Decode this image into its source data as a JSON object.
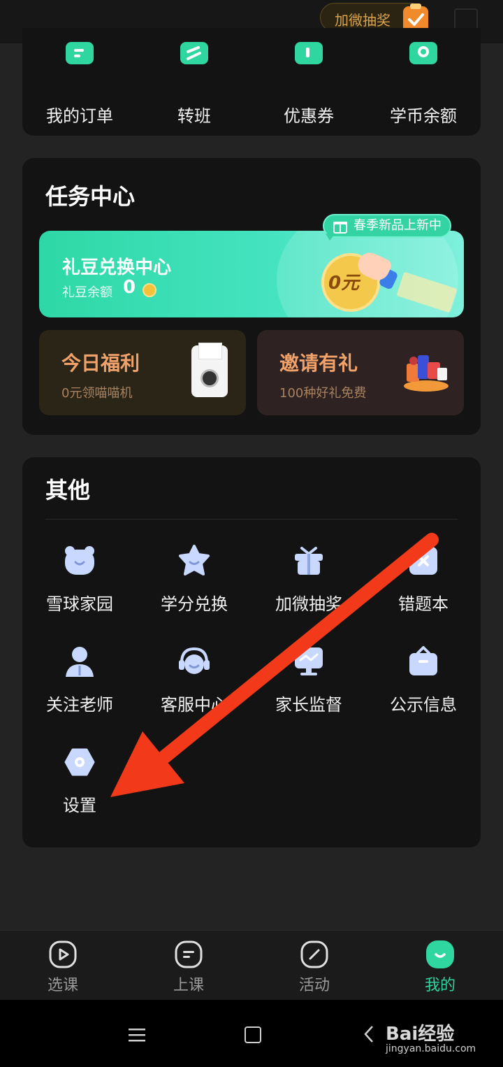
{
  "topbar": {
    "lottery_label": "加微抽奖"
  },
  "orders": {
    "items": [
      {
        "label": "我的订单",
        "icon": "order-icon"
      },
      {
        "label": "转班",
        "icon": "transfer-class-icon"
      },
      {
        "label": "优惠券",
        "icon": "coupon-icon"
      },
      {
        "label": "学币余额",
        "icon": "coin-balance-icon"
      }
    ]
  },
  "task_center": {
    "title": "任务中心",
    "banner": {
      "title": "礼豆兑换中心",
      "balance_label": "礼豆余额",
      "balance_value": "0",
      "coin_text": "0元",
      "tag": "春季新品上新中"
    },
    "welfare": {
      "title": "今日福利",
      "subtitle": "0元领喵喵机"
    },
    "invite": {
      "title": "邀请有礼",
      "subtitle": "100种好礼免费"
    }
  },
  "other": {
    "title": "其他",
    "items": [
      {
        "label": "雪球家园",
        "icon": "bear-icon"
      },
      {
        "label": "学分兑换",
        "icon": "star-icon"
      },
      {
        "label": "加微抽奖",
        "icon": "gift-icon"
      },
      {
        "label": "错题本",
        "icon": "wrong-notebook-icon"
      },
      {
        "label": "关注老师",
        "icon": "teacher-icon"
      },
      {
        "label": "客服中心",
        "icon": "headset-icon"
      },
      {
        "label": "家长监督",
        "icon": "monitor-icon"
      },
      {
        "label": "公示信息",
        "icon": "briefcase-icon"
      },
      {
        "label": "设置",
        "icon": "settings-icon"
      }
    ]
  },
  "colors": {
    "accent": "#2fd6a0",
    "arrow": "#f23a1a",
    "icon_fill": "#c9d8ff"
  },
  "nav": {
    "items": [
      {
        "label": "选课",
        "icon": "play-course-icon"
      },
      {
        "label": "上课",
        "icon": "class-icon"
      },
      {
        "label": "活动",
        "icon": "activity-icon"
      },
      {
        "label": "我的",
        "icon": "profile-icon",
        "active": true
      }
    ]
  },
  "watermark": {
    "brand": "Bai经验",
    "url": "jingyan.baidu.com"
  }
}
